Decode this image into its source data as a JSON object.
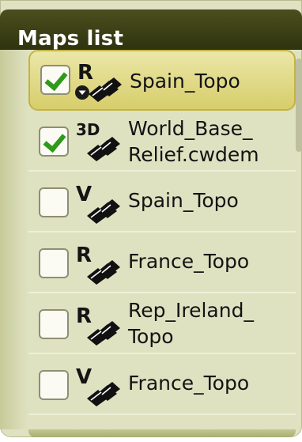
{
  "header": {
    "title": "Maps list"
  },
  "maps": [
    {
      "checked": true,
      "type": "R",
      "name_line1": "Spain_Topo",
      "name_line2": "",
      "selected": true,
      "has_sub_icon": true
    },
    {
      "checked": true,
      "type": "3D",
      "name_line1": "World_Base_",
      "name_line2": "Relief.cwdem",
      "selected": false,
      "has_sub_icon": false
    },
    {
      "checked": false,
      "type": "V",
      "name_line1": "Spain_Topo",
      "name_line2": "",
      "selected": false,
      "has_sub_icon": false
    },
    {
      "checked": false,
      "type": "R",
      "name_line1": "France_Topo",
      "name_line2": "",
      "selected": false,
      "has_sub_icon": false
    },
    {
      "checked": false,
      "type": "R",
      "name_line1": "Rep_Ireland_",
      "name_line2": "Topo",
      "selected": false,
      "has_sub_icon": false
    },
    {
      "checked": false,
      "type": "V",
      "name_line1": "France_Topo",
      "name_line2": "",
      "selected": false,
      "has_sub_icon": false
    }
  ],
  "colors": {
    "panel_bg": "#dfe2c1",
    "header_bg": "#3d421a",
    "selected_row": "#d7cd6b",
    "check": "#2f9a19"
  }
}
